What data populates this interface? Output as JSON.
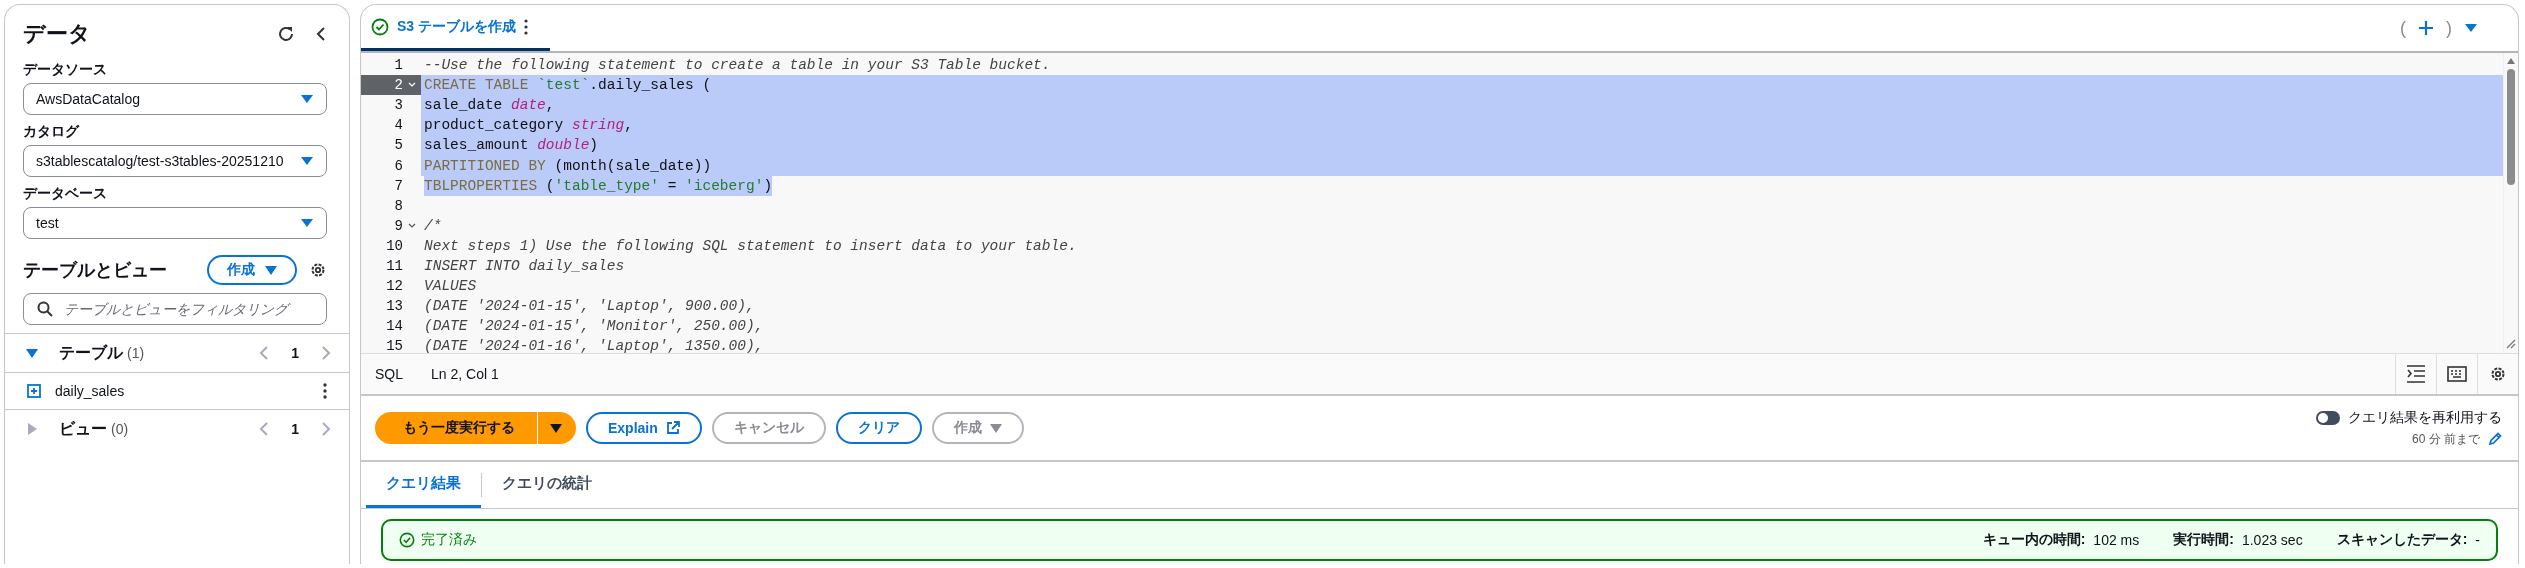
{
  "sidebar": {
    "title": "データ",
    "fields": [
      {
        "label": "データソース",
        "value": "AwsDataCatalog"
      },
      {
        "label": "カタログ",
        "value": "s3tablescatalog/test-s3tables-20251210"
      },
      {
        "label": "データベース",
        "value": "test"
      }
    ],
    "section_title": "テーブルとビュー",
    "create_button": "作成",
    "filter": {
      "placeholder": "テーブルとビューをフィルタリング"
    },
    "groups": [
      {
        "label": "テーブル",
        "count": "(1)",
        "expanded": true,
        "page": "1",
        "items": [
          "daily_sales"
        ]
      },
      {
        "label": "ビュー",
        "count": "(0)",
        "expanded": false,
        "page": "1"
      }
    ]
  },
  "tabs": [
    {
      "label": "S3 テーブルを作成",
      "selected": true
    }
  ],
  "tab_actions": {
    "left": "(",
    "right": ")"
  },
  "editor": {
    "lines": [
      {
        "number": "1",
        "selected": false,
        "active": false,
        "fold": false,
        "tokens": [
          {
            "kind": "comment",
            "text": "--Use the following statement to create a table in your S3 Table bucket."
          }
        ]
      },
      {
        "number": "2",
        "selected": true,
        "active": true,
        "fold": true,
        "tokens": [
          {
            "kind": "keyword",
            "text": "CREATE TABLE "
          },
          {
            "kind": "string",
            "text": "`test`"
          },
          {
            "kind": "plain",
            "text": ".daily_sales ("
          }
        ]
      },
      {
        "number": "3",
        "selected": true,
        "active": false,
        "fold": false,
        "tokens": [
          {
            "kind": "plain",
            "text": "sale_date "
          },
          {
            "kind": "type",
            "text": "date"
          },
          {
            "kind": "plain",
            "text": ","
          }
        ]
      },
      {
        "number": "4",
        "selected": true,
        "active": false,
        "fold": false,
        "tokens": [
          {
            "kind": "plain",
            "text": "product_category "
          },
          {
            "kind": "type",
            "text": "string"
          },
          {
            "kind": "plain",
            "text": ","
          }
        ]
      },
      {
        "number": "5",
        "selected": true,
        "active": false,
        "fold": false,
        "tokens": [
          {
            "kind": "plain",
            "text": "sales_amount "
          },
          {
            "kind": "type",
            "text": "double"
          },
          {
            "kind": "plain",
            "text": ")"
          }
        ]
      },
      {
        "number": "6",
        "selected": true,
        "active": false,
        "fold": false,
        "tokens": [
          {
            "kind": "keyword",
            "text": "PARTITIONED BY "
          },
          {
            "kind": "plain",
            "text": "(month(sale_date))"
          }
        ]
      },
      {
        "number": "7",
        "selected": true,
        "active": false,
        "fold": false,
        "tokens": [
          {
            "kind": "keyword",
            "text": "TBLPROPERTIES "
          },
          {
            "kind": "plain",
            "text": "("
          },
          {
            "kind": "string",
            "text": "'table_type'"
          },
          {
            "kind": "plain",
            "text": " = "
          },
          {
            "kind": "string",
            "text": "'iceberg'"
          },
          {
            "kind": "plain",
            "text": ")"
          }
        ]
      },
      {
        "number": "8",
        "selected": false,
        "active": false,
        "fold": false
      },
      {
        "number": "9",
        "selected": false,
        "active": false,
        "fold": true,
        "tokens": [
          {
            "kind": "comment",
            "text": "/*"
          }
        ]
      },
      {
        "number": "10",
        "selected": false,
        "active": false,
        "fold": false,
        "tokens": [
          {
            "kind": "comment",
            "text": "Next steps 1) Use the following SQL statement to insert data to your table."
          }
        ]
      },
      {
        "number": "11",
        "selected": false,
        "active": false,
        "fold": false,
        "tokens": [
          {
            "kind": "comment",
            "text": "INSERT INTO daily_sales"
          }
        ]
      },
      {
        "number": "12",
        "selected": false,
        "active": false,
        "fold": false,
        "tokens": [
          {
            "kind": "comment",
            "text": "VALUES"
          }
        ]
      },
      {
        "number": "13",
        "selected": false,
        "active": false,
        "fold": false,
        "tokens": [
          {
            "kind": "comment",
            "text": "(DATE '2024-01-15', 'Laptop', 900.00),"
          }
        ]
      },
      {
        "number": "14",
        "selected": false,
        "active": false,
        "fold": false,
        "tokens": [
          {
            "kind": "comment",
            "text": "(DATE '2024-01-15', 'Monitor', 250.00),"
          }
        ]
      },
      {
        "number": "15",
        "selected": false,
        "active": false,
        "fold": false,
        "tokens": [
          {
            "kind": "comment",
            "text": "(DATE '2024-01-16', 'Laptop', 1350.00),"
          }
        ]
      }
    ]
  },
  "status_bar": {
    "language": "SQL",
    "position": "Ln 2, Col 1"
  },
  "buttons": [
    {
      "kind": "primary",
      "label": "もう一度実行する",
      "disabled": false
    },
    {
      "kind": "external",
      "label": "Explain",
      "disabled": false
    },
    {
      "kind": "plain",
      "label": "キャンセル",
      "disabled": true
    },
    {
      "kind": "plain",
      "label": "クリア",
      "disabled": false
    },
    {
      "kind": "dropdown",
      "label": "作成",
      "disabled": true
    }
  ],
  "reuse": {
    "label": "クエリ結果を再利用する",
    "on": false,
    "detail": "60 分 前まで"
  },
  "result_tabs": [
    {
      "label": "クエリ結果",
      "selected": true
    },
    {
      "label": "クエリの統計",
      "selected": false
    }
  ],
  "result": {
    "status": "完了済み",
    "stats": [
      {
        "label": "キュー内の時間:",
        "value": "102 ms"
      },
      {
        "label": "実行時間:",
        "value": "1.023 sec"
      },
      {
        "label": "スキャンしたデータ:",
        "value": "-"
      }
    ]
  }
}
